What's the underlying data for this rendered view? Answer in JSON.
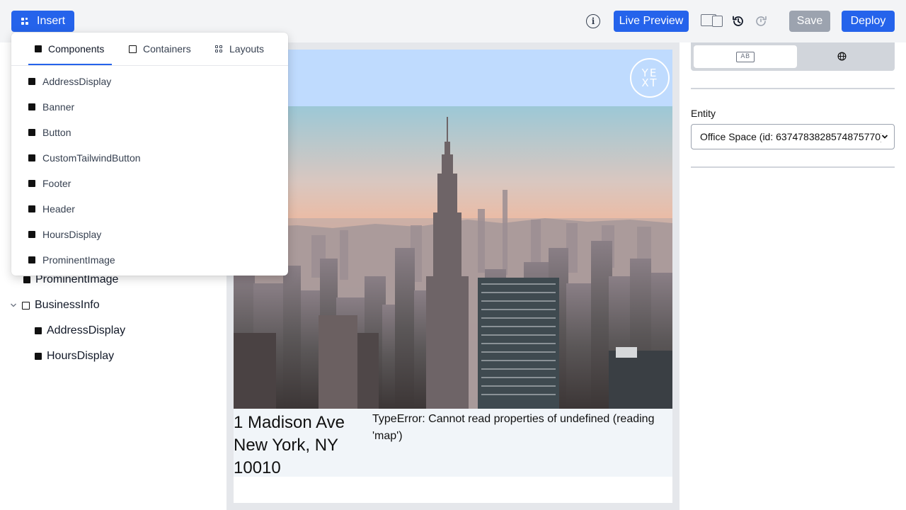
{
  "toolbar": {
    "insert_label": "Insert",
    "live_preview_label": "Live Preview",
    "save_label": "Save",
    "deploy_label": "Deploy"
  },
  "insert_menu": {
    "tabs": [
      {
        "label": "Components",
        "active": true
      },
      {
        "label": "Containers",
        "active": false
      },
      {
        "label": "Layouts",
        "active": false
      }
    ],
    "items": [
      "AddressDisplay",
      "Banner",
      "Button",
      "CustomTailwindButton",
      "Footer",
      "Header",
      "HoursDisplay",
      "ProminentImage"
    ]
  },
  "outline": {
    "items": [
      {
        "label": "ProminentImage",
        "type": "component"
      },
      {
        "label": "BusinessInfo",
        "type": "container",
        "expanded": true
      },
      {
        "label": "AddressDisplay",
        "type": "component"
      },
      {
        "label": "HoursDisplay",
        "type": "component"
      }
    ]
  },
  "canvas": {
    "logo_text": [
      "YE",
      "XT"
    ],
    "address": {
      "line1": "1 Madison Ave",
      "line2": "New York, NY",
      "line3": "10010"
    },
    "error_text": "TypeError: Cannot read properties of undefined (reading 'map')"
  },
  "right_panel": {
    "ab_icon_text": "AB",
    "entity_label": "Entity",
    "entity_value": "Office Space (id: 6374783828574875770)"
  },
  "colors": {
    "accent": "#2563eb",
    "disabled": "#9ca3af",
    "banner": "#bfdbfe",
    "toolbar_bg": "#f3f4f6"
  }
}
